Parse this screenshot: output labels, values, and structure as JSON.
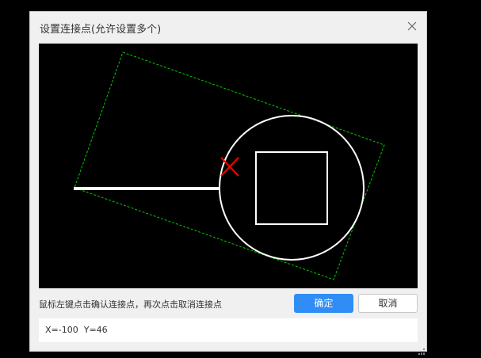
{
  "dialog": {
    "title": "设置连接点(允许设置多个)",
    "close_icon": "close-icon"
  },
  "canvas": {
    "background": "#000000",
    "shape_color": "#ffffff",
    "bounding_color": "#00ff00",
    "marker_color": "#ff0000",
    "marker_icon": "x-mark-icon"
  },
  "footer": {
    "hint": "鼠标左键点击确认连接点，再次点击取消连接点",
    "ok_label": "确定",
    "cancel_label": "取消",
    "ok_color": "#2f8df5"
  },
  "coords": {
    "x_label": "X=",
    "x_value": "-100",
    "y_label": "Y=",
    "y_value": "46"
  }
}
